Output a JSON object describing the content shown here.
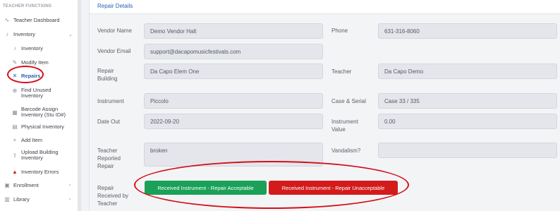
{
  "sidebar": {
    "section_header": "TEACHER FUNCTIONS",
    "teacher_dashboard": "Teacher Dashboard",
    "inventory": "Inventory",
    "sub_inventory": "Inventory",
    "modify_item": "Modify Item",
    "repairs": "Repairs",
    "find_unused": [
      "Find Unused",
      "Inventory"
    ],
    "barcode_assign": [
      "Barcode Assign",
      "Inventory (Stu ID#)"
    ],
    "physical_inventory": "Physical Inventory",
    "add_item": "Add Item",
    "upload_building": [
      "Upload Building",
      "Inventory"
    ],
    "inventory_errors": "Inventory Errors",
    "enrollment": "Enrollment",
    "library": "Library"
  },
  "card": {
    "title": "Repair Details"
  },
  "form": {
    "vendor_name_label": "Vendor Name",
    "vendor_name": "Demo Vendor Halt",
    "phone_label": "Phone",
    "phone": "631-316-8060",
    "vendor_email_label": "Vendor Email",
    "vendor_email": "support@dacapomusicfestivals.com",
    "repair_building_label": [
      "Repair",
      "Building"
    ],
    "repair_building": "Da Capo Elem One",
    "teacher_label": "Teacher",
    "teacher": "Da Capo Demo",
    "instrument_label": "Instrument",
    "instrument": "Piccolo",
    "case_serial_label": "Case & Serial",
    "case_serial": "Case 33 / 335",
    "date_out_label": "Date Out",
    "date_out": "2022-09-20",
    "instrument_value_label": [
      "Instrument",
      "Value"
    ],
    "instrument_value": "0.00",
    "teacher_reported_label": [
      "Teacher",
      "Reported",
      "Repair"
    ],
    "teacher_reported": "broken",
    "vandalism_label": "Vandalism?",
    "vandalism": "",
    "repair_received_label": [
      "Repair",
      "Received by",
      "Teacher"
    ]
  },
  "actions": {
    "acceptable": "Received Instrument - Repair Acceptable",
    "unacceptable": "Received Instrument - Repair Unacceptable"
  },
  "colors": {
    "accent": "#2563b8",
    "success": "#1aa157",
    "danger": "#d31b1b",
    "annotation": "#d40f1a"
  }
}
